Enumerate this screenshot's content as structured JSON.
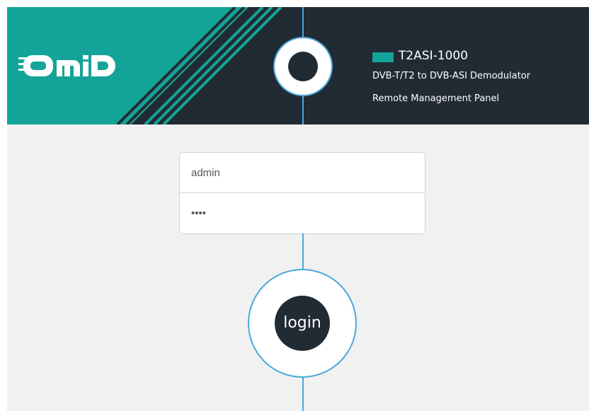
{
  "header": {
    "brand_text": "OMID",
    "product_name": "T2ASI-1000",
    "product_description": "DVB-T/T2 to DVB-ASI Demodulator",
    "product_subtitle": "Remote Management Panel"
  },
  "login_form": {
    "username_value": "admin",
    "password_value": "1234",
    "login_label": "login"
  },
  "colors": {
    "teal": "#14a398",
    "dark": "#212b33",
    "accent_line": "#4aa8dc",
    "background": "#f1f1f1"
  },
  "icons": {
    "brand_logo": "omid-logo"
  }
}
